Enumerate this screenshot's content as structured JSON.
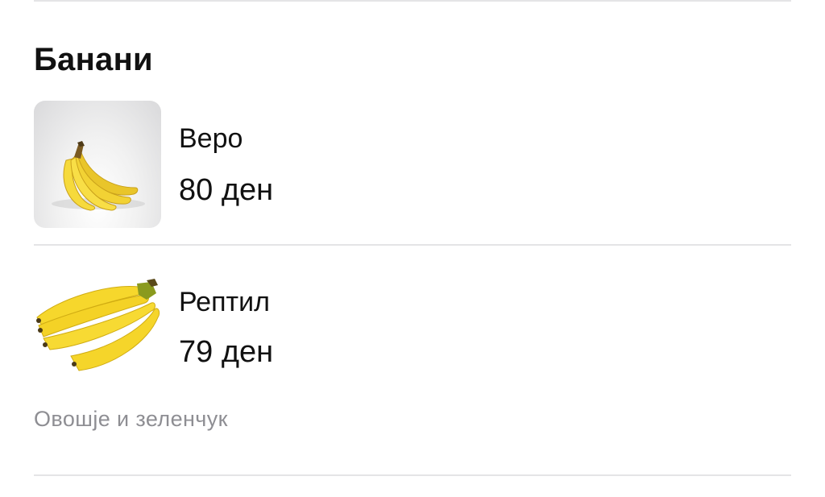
{
  "section": {
    "title": "Банани"
  },
  "products": [
    {
      "name": "Веро",
      "price": "80 ден",
      "image_icon": "banana-bunch-icon"
    },
    {
      "name": "Рептил",
      "price": "79 ден",
      "image_icon": "banana-bunch-icon"
    }
  ],
  "category": {
    "label": "Овошје и зеленчук"
  },
  "colors": {
    "text_primary": "#111111",
    "text_secondary": "#8e8e93",
    "divider": "#e4e4e6",
    "banana_yellow": "#f5d328"
  }
}
